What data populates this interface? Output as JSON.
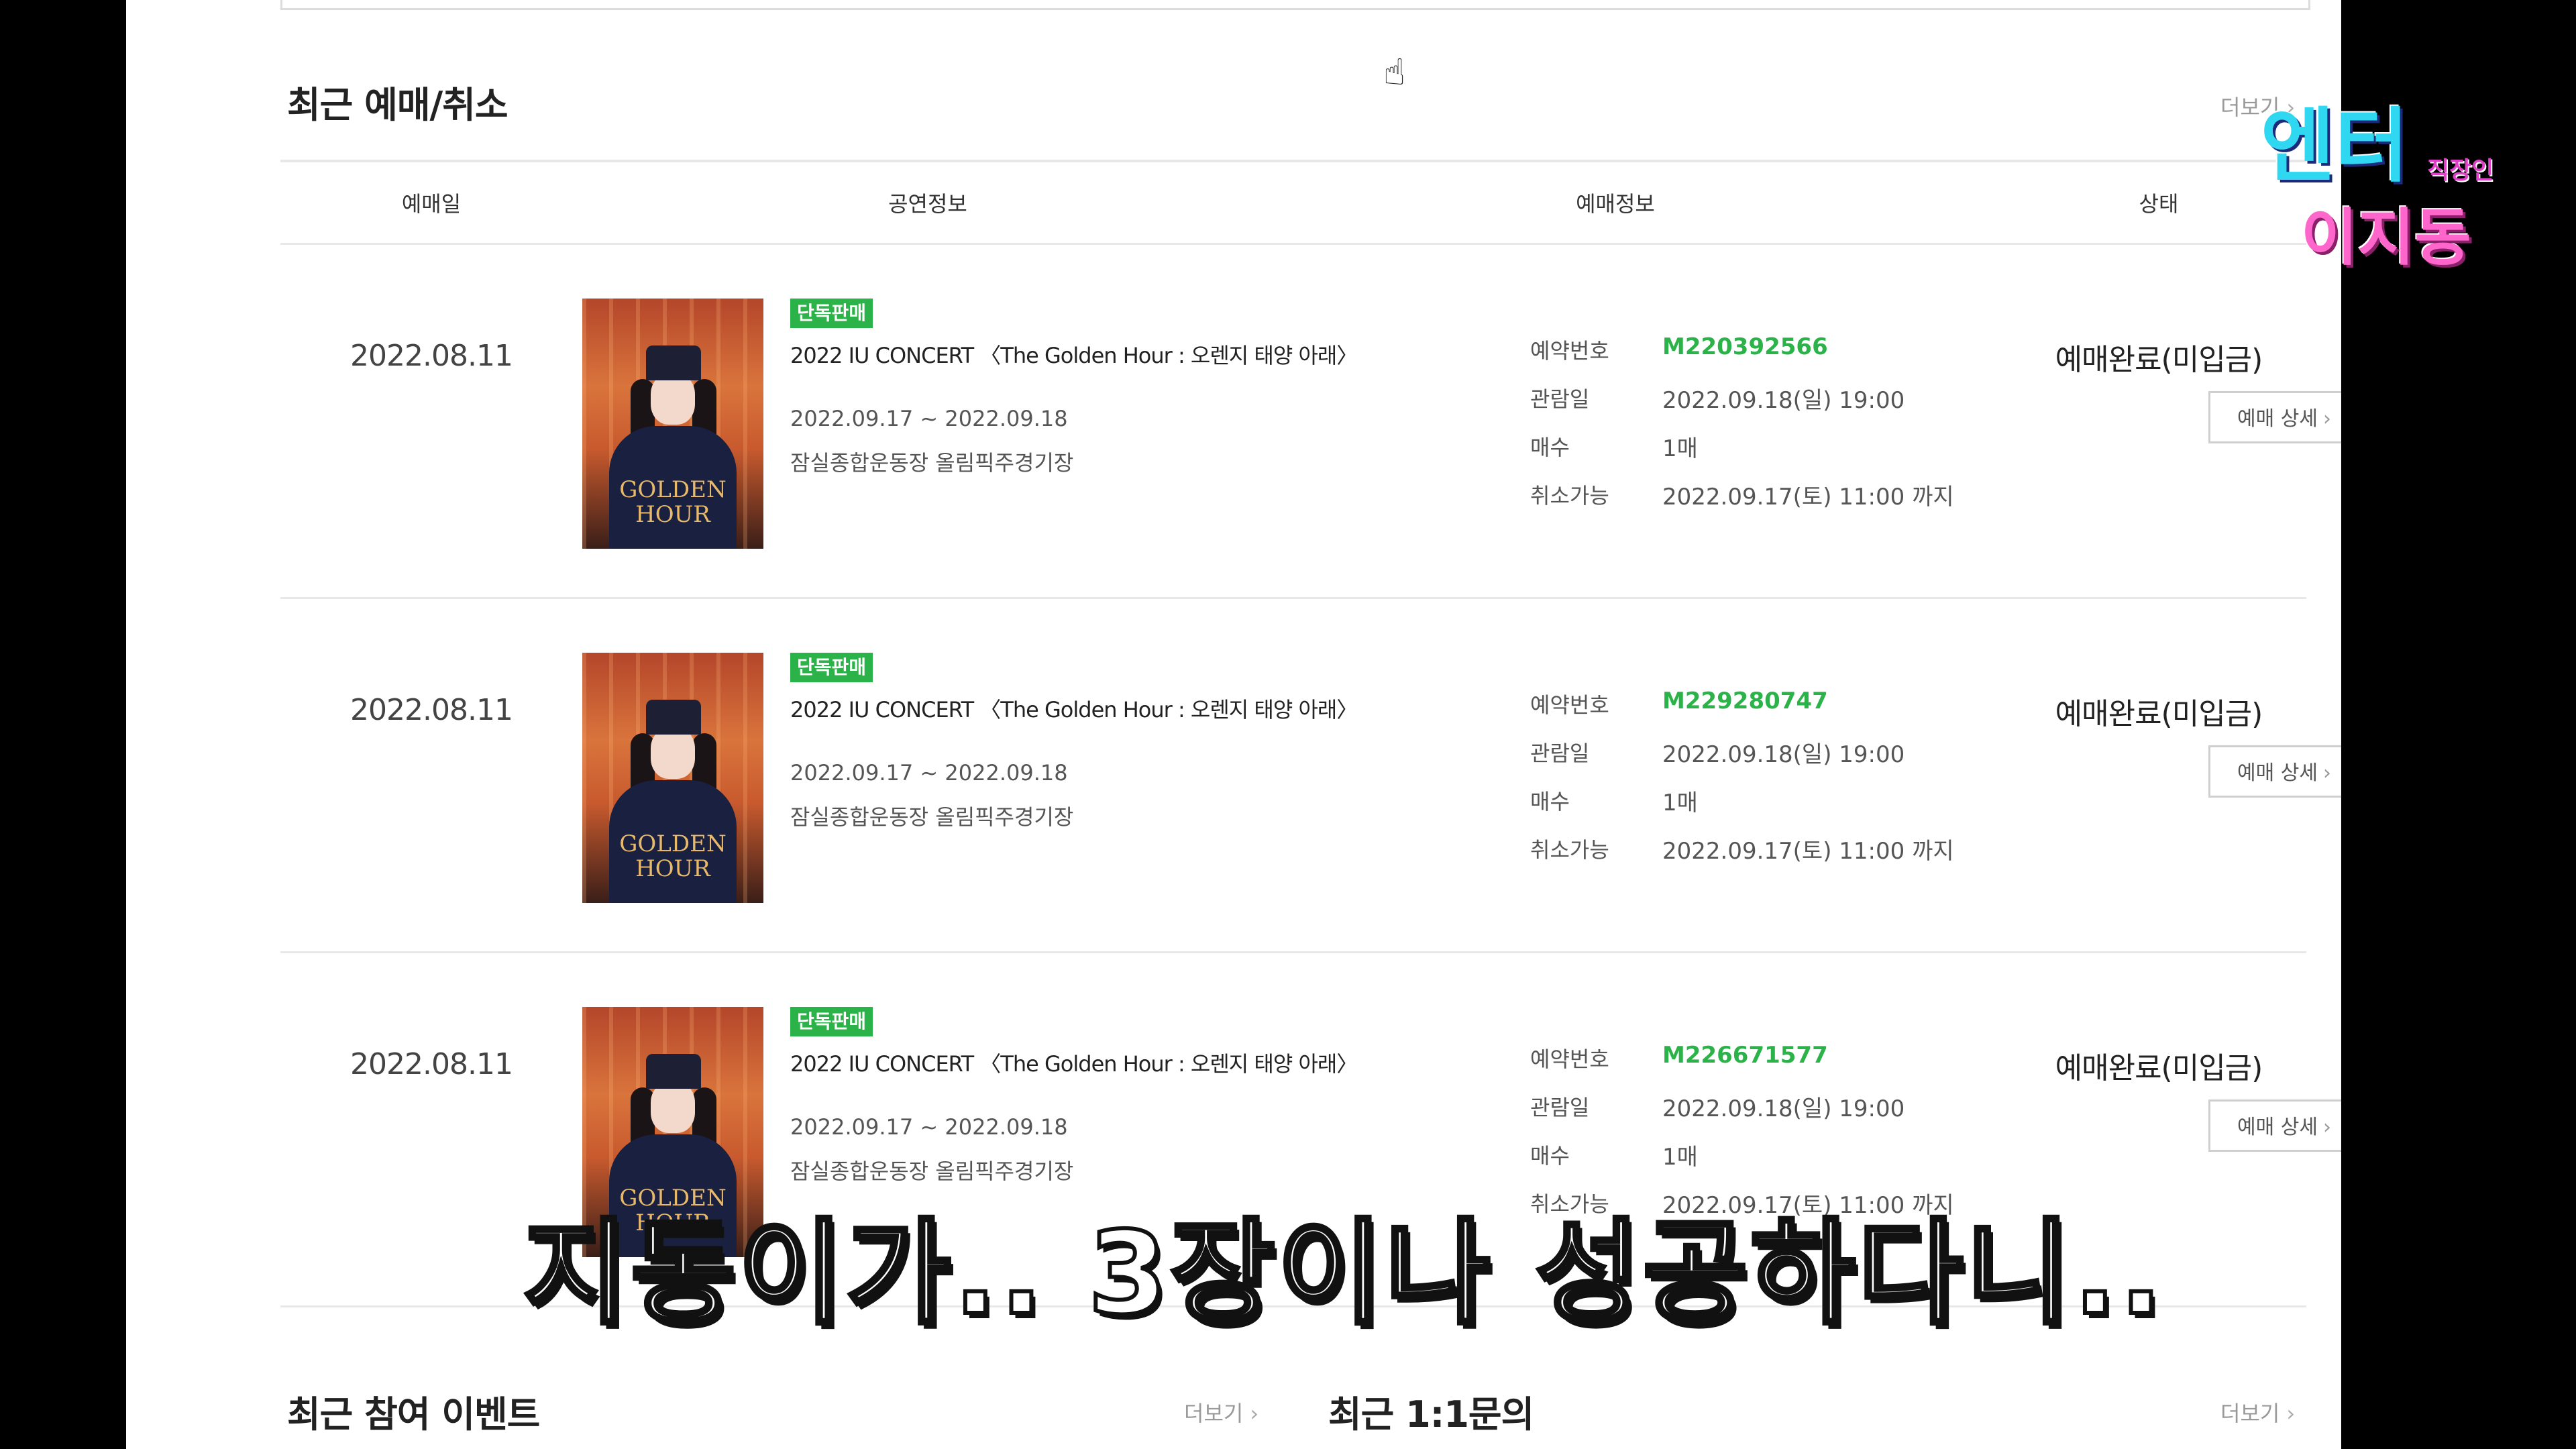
{
  "sections": {
    "recent_booking": {
      "title": "최근 예매/취소",
      "more": "더보기"
    },
    "recent_event": {
      "title": "최근 참여 이벤트",
      "more": "더보기"
    },
    "recent_inquiry": {
      "title": "최근 1:1문의",
      "more": "더보기"
    }
  },
  "table": {
    "headers": [
      "예매일",
      "공연정보",
      "예매정보",
      "상태"
    ],
    "field_labels": {
      "reservation_no": "예약번호",
      "view_date": "관람일",
      "count": "매수",
      "cancel": "취소가능"
    },
    "rows": [
      {
        "date": "2022.08.11",
        "badge": "단독판매",
        "concert": "2022 IU CONCERT 〈The Golden Hour : 오렌지 태양 아래〉",
        "period": "2022.09.17 ~ 2022.09.18",
        "venue": "잠실종합운동장 올림픽주경기장",
        "reservation_no": "M220392566",
        "view_date": "2022.09.18(일) 19:00",
        "count": "1매",
        "cancel": "2022.09.17(토) 11:00 까지",
        "status": "예매완료(미입금)",
        "detail_btn": "예매 상세"
      },
      {
        "date": "2022.08.11",
        "badge": "단독판매",
        "concert": "2022 IU CONCERT 〈The Golden Hour : 오렌지 태양 아래〉",
        "period": "2022.09.17 ~ 2022.09.18",
        "venue": "잠실종합운동장 올림픽주경기장",
        "reservation_no": "M229280747",
        "view_date": "2022.09.18(일) 19:00",
        "count": "1매",
        "cancel": "2022.09.17(토) 11:00 까지",
        "status": "예매완료(미입금)",
        "detail_btn": "예매 상세"
      },
      {
        "date": "2022.08.11",
        "badge": "단독판매",
        "concert": "2022 IU CONCERT 〈The Golden Hour : 오렌지 태양 아래〉",
        "period": "2022.09.17 ~ 2022.09.18",
        "venue": "잠실종합운동장 올림픽주경기장",
        "reservation_no": "M226671577",
        "view_date": "2022.09.18(일) 19:00",
        "count": "1매",
        "cancel": "2022.09.17(토) 11:00 까지",
        "status": "예매완료(미입금)",
        "detail_btn": "예매 상세"
      }
    ]
  },
  "poster": {
    "title_line1": "GOLDEN",
    "title_line2": "HOUR"
  },
  "overlay": {
    "logo_main": "엔터",
    "logo_sub": "직장인",
    "logo_name": "이지동",
    "caption": "지동이가.. 3장이나 성공하다니.."
  },
  "colors": {
    "accent_green": "#2bb34a",
    "logo_cyan": "#2fd8f0",
    "logo_pink": "#ff66cc"
  },
  "icons": {
    "cursor": "hand-pointer-icon",
    "chevron": "chevron-right-icon"
  }
}
